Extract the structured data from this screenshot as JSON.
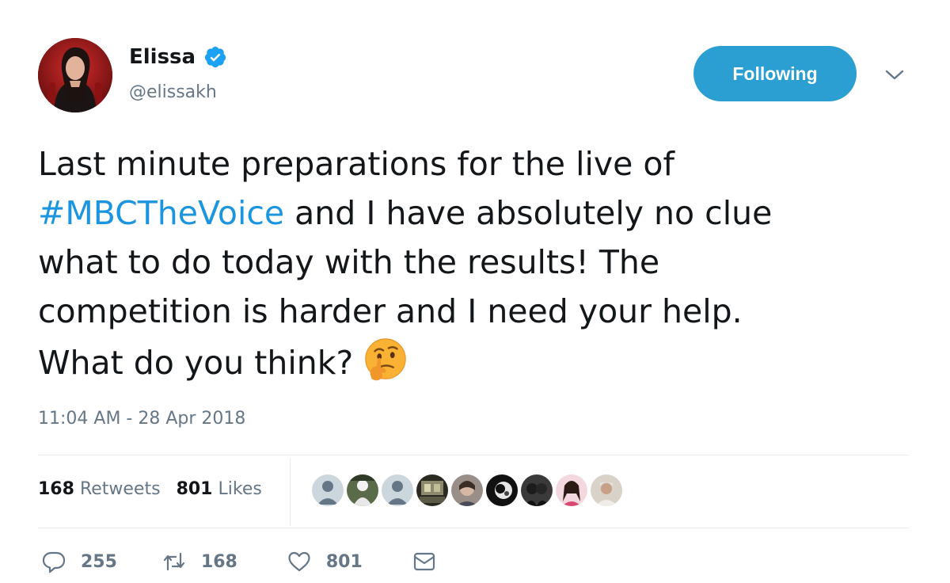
{
  "user": {
    "display_name": "Elissa",
    "handle": "@elissakh",
    "verified": true
  },
  "follow_button": {
    "label": "Following"
  },
  "tweet": {
    "lines": [
      "Last minute preparations for the live of",
      "and I have absolutely no clue",
      "what to do today with the results! The",
      "competition is harder and I need your help.",
      "What do you think?"
    ],
    "hashtag": "#MBCTheVoice",
    "emoji": "thinking-face",
    "timestamp": "11:04 AM - 28 Apr 2018"
  },
  "stats": {
    "retweets_count": "168",
    "retweets_label": "Retweets",
    "likes_count": "801",
    "likes_label": "Likes"
  },
  "actions": {
    "replies": "255",
    "retweets": "168",
    "likes": "801"
  },
  "colors": {
    "accent": "#1b95e0",
    "follow_button": "#2b9fd2",
    "muted_text": "#657786",
    "divider": "#e6ecf0"
  },
  "icons": [
    "verified-badge-icon",
    "chevron-down-icon",
    "thinking-face-emoji",
    "reply-icon",
    "retweet-icon",
    "heart-icon",
    "envelope-icon"
  ]
}
